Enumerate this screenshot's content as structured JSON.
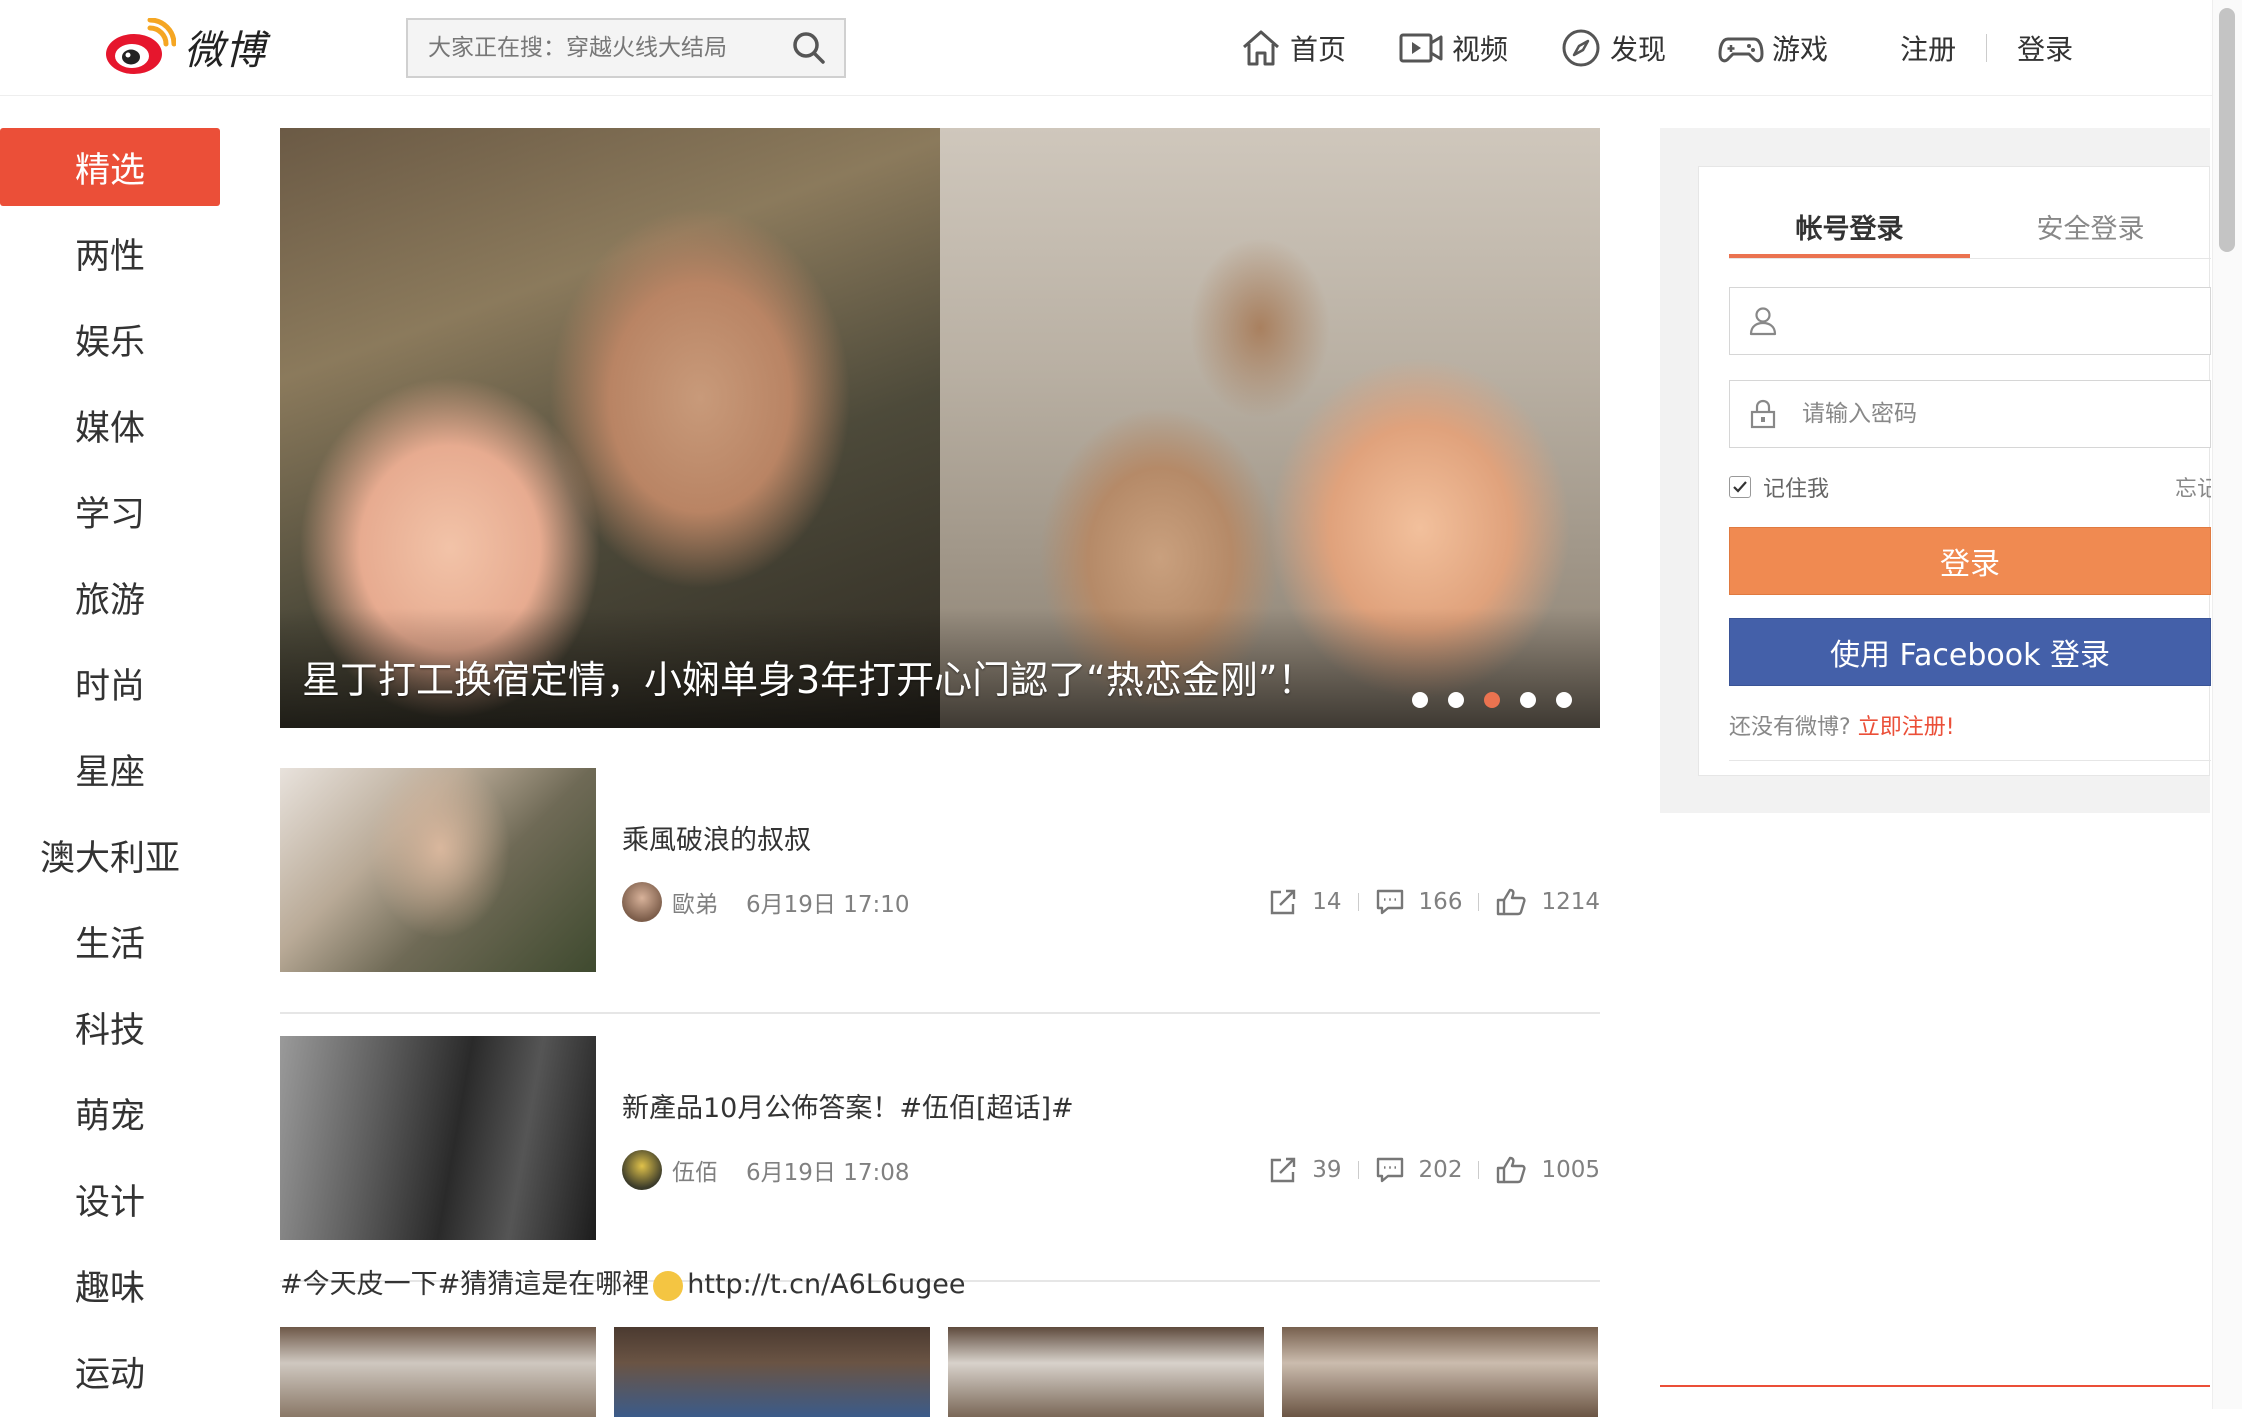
{
  "header": {
    "logo_text": "微博",
    "search_placeholder": "大家正在搜：穿越火线大结局",
    "nav": [
      {
        "label": "首页",
        "icon": "home-icon"
      },
      {
        "label": "视频",
        "icon": "video-icon"
      },
      {
        "label": "发现",
        "icon": "compass-icon"
      },
      {
        "label": "游戏",
        "icon": "gamepad-icon"
      }
    ],
    "register": "注册",
    "login": "登录"
  },
  "sidebar": {
    "items": [
      {
        "label": "精选",
        "active": true
      },
      {
        "label": "两性"
      },
      {
        "label": "娱乐"
      },
      {
        "label": "媒体"
      },
      {
        "label": "学习"
      },
      {
        "label": "旅游"
      },
      {
        "label": "时尚"
      },
      {
        "label": "星座"
      },
      {
        "label": "澳大利亚"
      },
      {
        "label": "生活"
      },
      {
        "label": "科技"
      },
      {
        "label": "萌宠"
      },
      {
        "label": "设计"
      },
      {
        "label": "趣味"
      },
      {
        "label": "运动"
      }
    ]
  },
  "banner": {
    "caption": "星丁打工换宿定情，小娴单身3年打开心门認了“热恋金刚”！",
    "dots": 5,
    "active_dot": 3
  },
  "feed": [
    {
      "title": "乘風破浪的叔叔",
      "author": "歐弟",
      "time": "6月19日 17:10",
      "shares": "14",
      "comments": "166",
      "likes": "1214"
    },
    {
      "title": "新產品10月公佈答案！#伍佰[超话]#",
      "author": "伍佰",
      "time": "6月19日 17:08",
      "shares": "39",
      "comments": "202",
      "likes": "1005"
    }
  ],
  "post": {
    "text_before": "#今天皮一下#猜猜這是在哪裡",
    "text_after": "http://t.cn/A6L6ugee"
  },
  "login_panel": {
    "tab_account": "帐号登录",
    "tab_secure": "安全登录",
    "username_placeholder": "",
    "password_placeholder": "请输入密码",
    "remember": "记住我",
    "forgot": "忘记",
    "login_button": "登录",
    "facebook_button": "使用 Facebook 登录",
    "no_account": "还没有微博?",
    "register_link": "立即注册!"
  },
  "colors": {
    "accent_red": "#eb4f38",
    "accent_orange": "#f08a51",
    "facebook_blue": "#4460a9"
  }
}
